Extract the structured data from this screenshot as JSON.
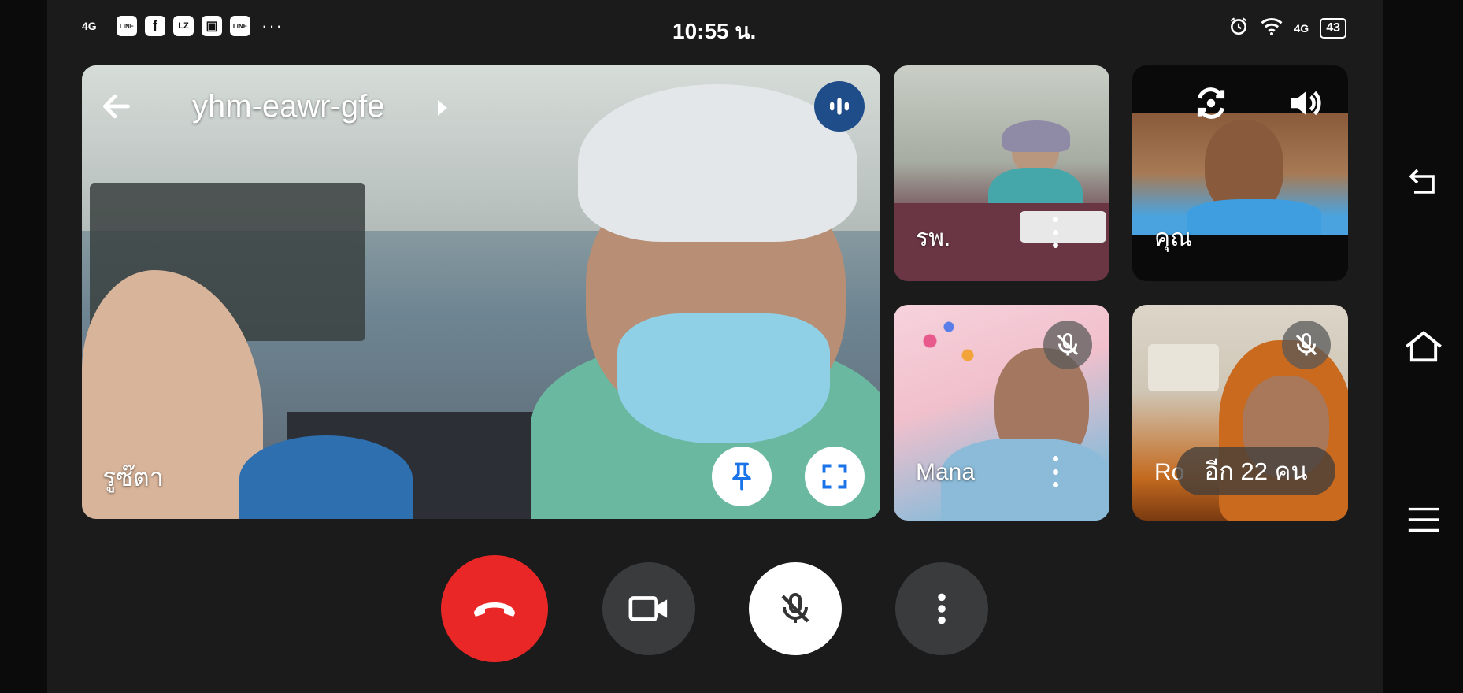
{
  "status_bar": {
    "signal_label": "4G",
    "app_icons": [
      "LINE",
      "f",
      "LZ",
      "▣",
      "LINE"
    ],
    "more": "···",
    "time": "10:55 น.",
    "network": "4G",
    "battery": "43"
  },
  "meeting": {
    "code": "yhm-eawr-gfe"
  },
  "main_tile": {
    "name": "รูซ๊ตา"
  },
  "tiles": [
    {
      "name": "รพ.",
      "muted": false
    },
    {
      "name": "คุณ",
      "muted": false
    },
    {
      "name": "Mana",
      "muted": true
    },
    {
      "name": "Ro",
      "muted": true,
      "more_badge": "อีก 22 คน"
    }
  ],
  "icons": {
    "back": "arrow-left-icon",
    "speaking": "audio-level-icon",
    "pin": "pin-icon",
    "fullscreen": "fullscreen-icon",
    "switch_camera": "switch-camera-icon",
    "speaker": "speaker-icon",
    "mic_off": "mic-off-icon",
    "end_call": "end-call-icon",
    "camera": "camera-icon",
    "more": "more-vert-icon"
  },
  "colors": {
    "end_call": "#ea2727",
    "speaking_badge": "#1e4d8a",
    "pin_icon": "#1a73e8"
  }
}
